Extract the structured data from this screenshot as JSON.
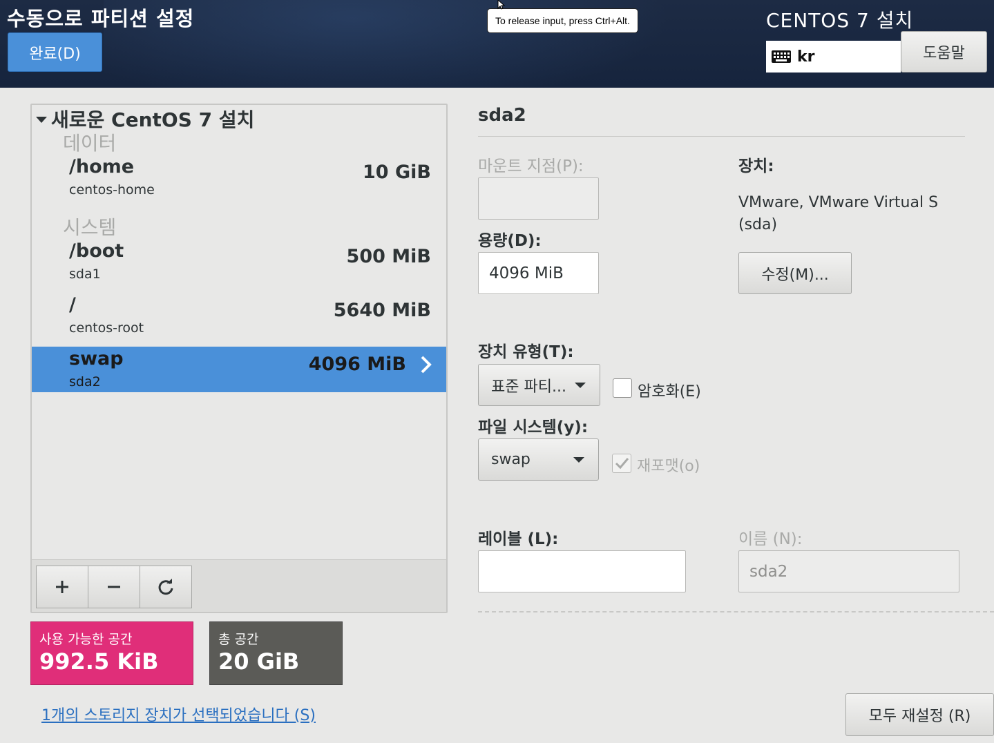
{
  "header": {
    "title": "수동으로 파티션 설정",
    "done_label": "완료(D)",
    "tooltip": "To release input, press Ctrl+Alt.",
    "product": "CENTOS 7 설치",
    "keyboard_layout": "kr",
    "help_label": "도움말"
  },
  "tree": {
    "root_label": "새로운 CentOS 7 설치",
    "groups": [
      {
        "label": "데이터",
        "items": [
          {
            "mount": "/home",
            "device": "centos-home",
            "size": "10 GiB"
          }
        ]
      },
      {
        "label": "시스템",
        "items": [
          {
            "mount": "/boot",
            "device": "sda1",
            "size": "500 MiB"
          },
          {
            "mount": "/",
            "device": "centos-root",
            "size": "5640 MiB"
          },
          {
            "mount": "swap",
            "device": "sda2",
            "size": "4096 MiB",
            "selected": true
          }
        ]
      }
    ],
    "toolbar": {
      "add": "+",
      "remove": "−",
      "refresh": "↻"
    }
  },
  "space": {
    "available_label": "사용 가능한 공간",
    "available_value": "992.5 KiB",
    "total_label": "총 공간",
    "total_value": "20 GiB",
    "available_color": "#e02e79",
    "total_color": "#5b5b57"
  },
  "storage_link": "1개의 스토리지 장치가 선택되었습니다 (S)",
  "detail": {
    "title": "sda2",
    "mount_point_label": "마운트 지점(P):",
    "mount_point_value": "",
    "capacity_label": "용량(D):",
    "capacity_value": "4096 MiB",
    "device_label": "장치:",
    "device_text_line1": "VMware, VMware Virtual S",
    "device_text_line2": "(sda)",
    "modify_label": "수정(M)...",
    "device_type_label": "장치 유형(T):",
    "device_type_value": "표준 파티...",
    "encrypt_label": "암호화(E)",
    "encrypt_checked": false,
    "filesystem_label": "파일 시스템(y):",
    "filesystem_value": "swap",
    "reformat_label": "재포맷(o)",
    "reformat_checked": true,
    "label_label": "레이블 (L):",
    "label_value": "",
    "name_label": "이름 (N):",
    "name_value": "sda2",
    "reset_label": "모두 재설정 (R)"
  }
}
